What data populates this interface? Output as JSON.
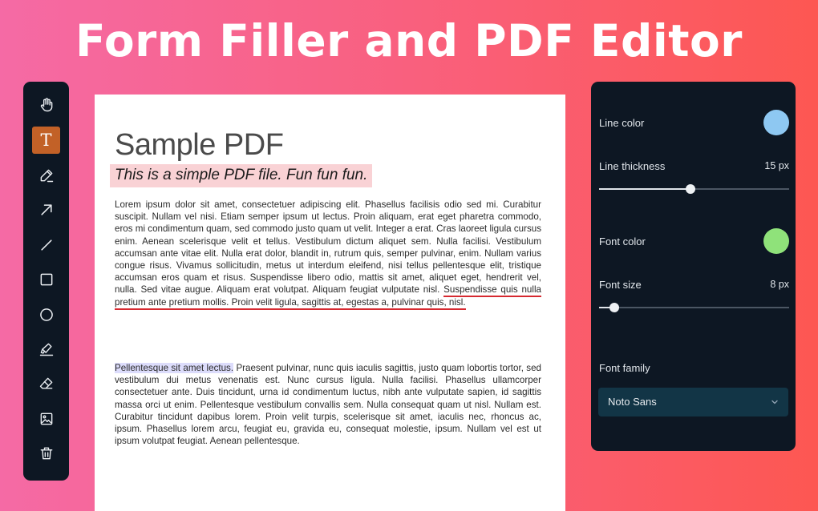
{
  "headline": "Form Filler and PDF Editor",
  "toolbar": {
    "tools": [
      {
        "name": "hand",
        "icon": "hand-icon",
        "active": false
      },
      {
        "name": "text",
        "icon": "text-icon",
        "glyph": "T",
        "active": true
      },
      {
        "name": "pencil",
        "icon": "pencil-icon",
        "active": false
      },
      {
        "name": "arrow",
        "icon": "arrow-icon",
        "active": false
      },
      {
        "name": "line",
        "icon": "line-icon",
        "active": false
      },
      {
        "name": "rectangle",
        "icon": "rectangle-icon",
        "active": false
      },
      {
        "name": "ellipse",
        "icon": "circle-icon",
        "active": false
      },
      {
        "name": "highlighter",
        "icon": "highlighter-icon",
        "active": false
      },
      {
        "name": "eraser",
        "icon": "eraser-icon",
        "active": false
      },
      {
        "name": "image",
        "icon": "image-icon",
        "active": false
      },
      {
        "name": "delete",
        "icon": "trash-icon",
        "active": false
      }
    ],
    "active_color": "#c26127"
  },
  "document": {
    "title": "Sample PDF",
    "subtitle": "This is a simple PDF file. Fun fun fun.",
    "paragraph1_a": "Lorem ipsum dolor sit amet, consectetuer adipiscing elit. Phasellus facilisis odio sed mi. Curabitur suscipit. Nullam vel nisi. Etiam semper ipsum ut lectus. Proin aliquam, erat eget pharetra commodo, eros mi condimentum quam, sed commodo justo quam ut velit. Integer a erat. Cras laoreet ligula cursus enim. Aenean scelerisque velit et tellus. Vestibulum dictum aliquet sem. Nulla facilisi. Vestibulum accumsan ante vitae elit. Nulla erat dolor, blandit in, rutrum quis, semper pulvinar, enim. Nullam varius congue risus. Vivamus sollicitudin, metus ut interdum eleifend, nisi tellus pellentesque elit, tristique accumsan eros quam et risus. Suspendisse libero odio, mattis sit amet, aliquet eget, hendrerit vel, nulla. Sed vitae augue. Aliquam erat volutpat. Aliquam feugiat vulputate nisl.",
    "paragraph1_underlined": "Suspendisse quis nulla pretium ante pretium mollis. Proin velit ligula, sagittis at, egestas a, pulvinar quis, nisl.",
    "paragraph2_highlighted": "Pellentesque sit amet lectus.",
    "paragraph2_rest": " Praesent pulvinar, nunc quis iaculis sagittis, justo quam lobortis tortor, sed vestibulum dui metus venenatis est. Nunc cursus ligula. Nulla facilisi. Phasellus ullamcorper consectetuer ante. Duis tincidunt, urna id condimentum luctus, nibh ante vulputate sapien, id sagittis massa orci ut enim. Pellentesque vestibulum convallis sem. Nulla consequat quam ut nisl. Nullam est. Curabitur tincidunt dapibus lorem. Proin velit turpis, scelerisque sit amet, iaculis nec, rhoncus ac, ipsum. Phasellus lorem arcu, feugiat eu, gravida eu, consequat molestie, ipsum. Nullam vel est ut ipsum volutpat feugiat. Aenean pellentesque.",
    "subtitle_highlight_color": "#f9d2d5",
    "underline_color": "#d62930",
    "text_highlight_color": "#dcdcfb"
  },
  "panel": {
    "line_color_label": "Line color",
    "line_color": "#8ec8f2",
    "line_thickness_label": "Line thickness",
    "line_thickness_value": "15 px",
    "line_thickness_fraction": 0.48,
    "font_color_label": "Font color",
    "font_color": "#8fe27a",
    "font_size_label": "Font size",
    "font_size_value": "8 px",
    "font_size_fraction": 0.08,
    "font_family_label": "Font family",
    "font_family_value": "Noto Sans"
  }
}
